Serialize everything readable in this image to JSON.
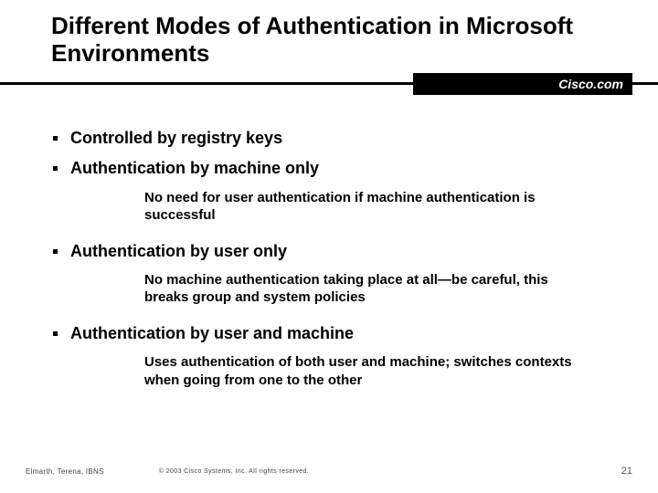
{
  "title": "Different Modes of Authentication in Microsoft Environments",
  "brand": "Cisco.com",
  "bullets": [
    {
      "text": "Controlled by registry keys",
      "sub": null
    },
    {
      "text": "Authentication by machine only",
      "sub": "No need for user authentication if machine authentication is successful"
    },
    {
      "text": "Authentication by user only",
      "sub": "No machine authentication taking place at all—be careful, this breaks group and system policies"
    },
    {
      "text": "Authentication by user and machine",
      "sub": "Uses authentication of both user and machine; switches contexts when going from one to the other"
    }
  ],
  "footer": {
    "left": "Elmarth, Terena, IBNS",
    "center": "© 2003 Cisco Systems, Inc. All rights reserved.",
    "right": "21"
  }
}
